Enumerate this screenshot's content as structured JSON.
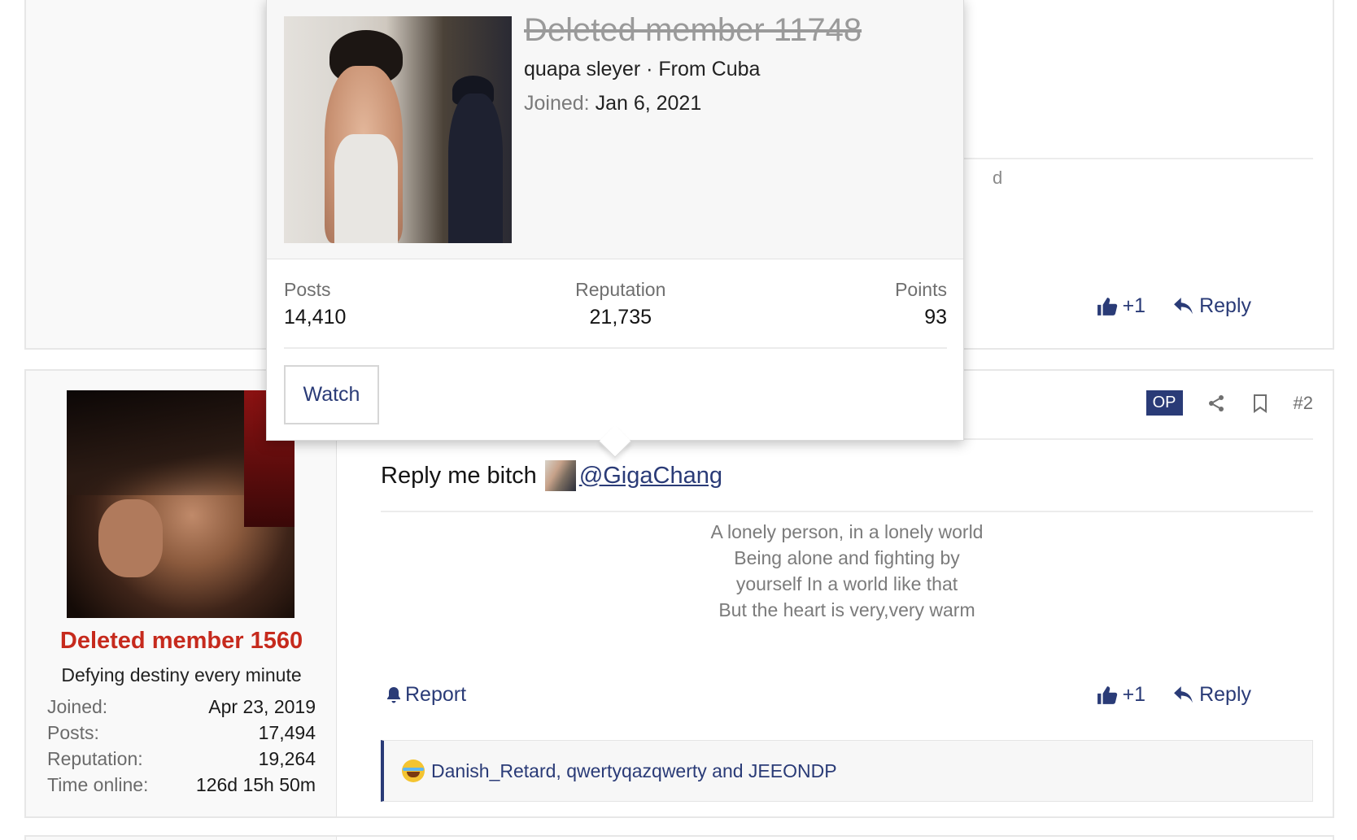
{
  "post1": {
    "fragment_text": "d",
    "actions": {
      "like_label": "+1",
      "reply_label": "Reply"
    }
  },
  "post2": {
    "author": {
      "name": "Deleted member 1560",
      "title": "Defying destiny every minute",
      "stats": [
        {
          "label": "Joined:",
          "value": "Apr 23, 2019"
        },
        {
          "label": "Posts:",
          "value": "17,494"
        },
        {
          "label": "Reputation:",
          "value": "19,264"
        },
        {
          "label": "Time online:",
          "value": "126d 15h 50m"
        }
      ]
    },
    "op_badge": "OP",
    "post_number": "#2",
    "message_text": "Reply me bitch",
    "mention": "@GigaChang",
    "signature": [
      "A lonely person, in a lonely world",
      "Being alone and fighting by",
      "yourself In a world like that",
      "But the heart is very,very warm"
    ],
    "report_label": "Report",
    "actions": {
      "like_label": "+1",
      "reply_label": "Reply"
    },
    "reactions": {
      "users": "Danish_Retard, qwertyqazqwerty and JEEONDP"
    }
  },
  "popup": {
    "name": "Deleted member 11748",
    "subtitle": "quapa sleyer · From Cuba",
    "joined_label": "Joined:",
    "joined_value": "Jan 6, 2021",
    "stats": {
      "posts_label": "Posts",
      "posts_value": "14,410",
      "rep_label": "Reputation",
      "rep_value": "21,735",
      "points_label": "Points",
      "points_value": "93"
    },
    "watch_label": "Watch"
  },
  "colors": {
    "accent": "#2a3b77",
    "deleted_member_red": "#c62a1d"
  }
}
